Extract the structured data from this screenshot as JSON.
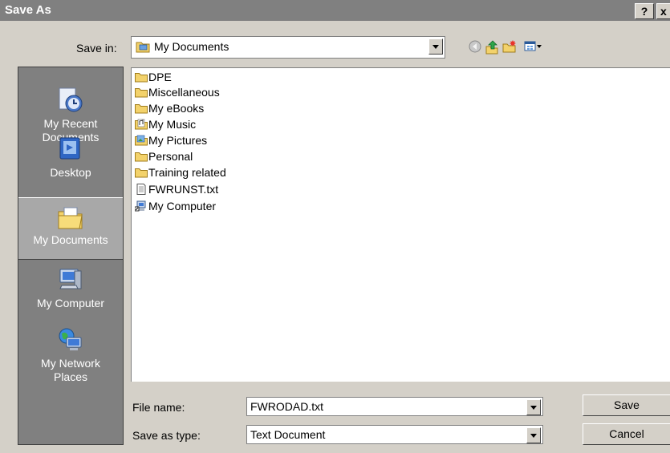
{
  "window": {
    "title": "Save As",
    "help_label": "?",
    "close_label": "x"
  },
  "save_in": {
    "label": "Save in:",
    "value": "My Documents"
  },
  "toolbar": {
    "icons": [
      "back-icon",
      "up-folder-icon",
      "new-folder-icon",
      "view-menu-icon"
    ]
  },
  "places": [
    {
      "label": "My Recent\nDocuments",
      "icon": "recent-documents-icon"
    },
    {
      "label": "Desktop",
      "icon": "desktop-icon"
    },
    {
      "label": "My Documents",
      "icon": "my-documents-icon",
      "selected": true
    },
    {
      "label": "My Computer",
      "icon": "my-computer-icon"
    },
    {
      "label": "My Network\nPlaces",
      "icon": "network-places-icon"
    }
  ],
  "files": [
    {
      "name": "DPE",
      "icon": "folder-icon"
    },
    {
      "name": "Miscellaneous",
      "icon": "folder-icon"
    },
    {
      "name": "My eBooks",
      "icon": "folder-icon"
    },
    {
      "name": "My Music",
      "icon": "music-folder-icon"
    },
    {
      "name": "My Pictures",
      "icon": "pictures-folder-icon"
    },
    {
      "name": "Personal",
      "icon": "folder-icon"
    },
    {
      "name": "Training related",
      "icon": "folder-icon"
    },
    {
      "name": "FWRUNST.txt",
      "icon": "text-file-icon"
    },
    {
      "name": "My Computer",
      "icon": "computer-shortcut-icon"
    }
  ],
  "file_name": {
    "label": "File name:",
    "value": "FWRODAD.txt"
  },
  "save_type": {
    "label": "Save as type:",
    "value": "Text Document"
  },
  "buttons": {
    "save": "Save",
    "cancel": "Cancel"
  },
  "colors": {
    "title_bar": "#808080",
    "dialog_bg": "#d4d0c8",
    "places_bg": "#808080",
    "folder": "#f3d26b"
  }
}
